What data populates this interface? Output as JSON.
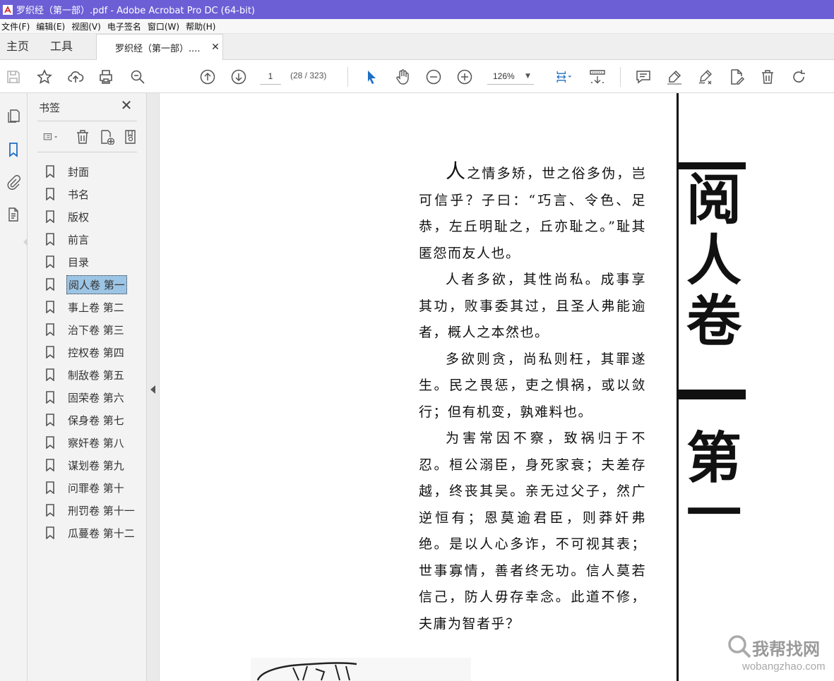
{
  "window": {
    "title": "罗织经（第一部）.pdf - Adobe Acrobat Pro DC (64-bit)"
  },
  "menu": [
    "文件(F)",
    "编辑(E)",
    "视图(V)",
    "电子签名",
    "窗口(W)",
    "帮助(H)"
  ],
  "tabs": {
    "home": "主页",
    "tools": "工具",
    "document": "罗织经（第一部）...."
  },
  "toolbar": {
    "page_number": "1",
    "page_count": "(28 / 323)",
    "zoom": "126%"
  },
  "bookmarks": {
    "title": "书签",
    "items": [
      {
        "label": "封面"
      },
      {
        "label": "书名"
      },
      {
        "label": "版权"
      },
      {
        "label": "前言"
      },
      {
        "label": "目录"
      },
      {
        "label": "阅人卷 第一",
        "selected": true
      },
      {
        "label": "事上卷 第二"
      },
      {
        "label": "治下卷 第三"
      },
      {
        "label": "控权卷 第四"
      },
      {
        "label": "制敌卷 第五"
      },
      {
        "label": "固荣卷 第六"
      },
      {
        "label": "保身卷 第七"
      },
      {
        "label": "察奸卷 第八"
      },
      {
        "label": "谋划卷 第九"
      },
      {
        "label": "问罪卷 第十"
      },
      {
        "label": "刑罚卷 第十一"
      },
      {
        "label": "瓜蔓卷 第十二"
      }
    ]
  },
  "document": {
    "paragraphs": {
      "p1_drop": "人",
      "p1_rest": "之情多矫，世之俗多伪，岂可信乎？子曰：“巧言、令色、足恭，左丘明耻之，丘亦耻之。”耻其匿怨而友人也。",
      "p2": "人者多欲，其性尚私。成事享其功，败事委其过，且圣人弗能逾者，概人之本然也。",
      "p3": "多欲则贪，尚私则枉，其罪遂生。民之畏惩，吏之惧祸，或以敛行；但有机变，孰难料也。",
      "p4": "为害常因不察，致祸归于不忍。桓公溺臣，身死家衰；夫差存越，终丧其吴。亲无过父子，然广逆恒有；恩莫逾君臣，则莽奸弗绝。是以人心多诈，不可视其表；世事寡情，善者终无功。信人莫若信己，防人毋存幸念。此道不修，夫庸为智者乎？"
    },
    "chapter_title_chars": [
      "阅",
      "人",
      "卷",
      "第",
      "一"
    ]
  },
  "watermark": {
    "logo": "我帮找网",
    "url": "wobangzhao.com"
  },
  "colors": {
    "titlebar": "#6c5fd6",
    "accent_blue": "#1f6fc4",
    "selection": "#9cc4e4"
  }
}
